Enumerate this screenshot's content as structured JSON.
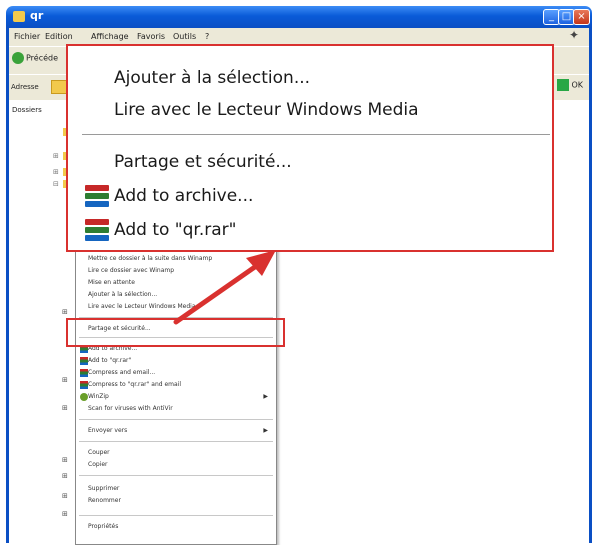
{
  "window": {
    "title": "qr"
  },
  "menubar": {
    "items": [
      "Fichier",
      "Edition",
      "Affichage",
      "Favoris",
      "Outils",
      "?"
    ]
  },
  "toolbar": {
    "back_label": "Précéde"
  },
  "addressbar": {
    "label": "Adresse",
    "ok_label": "OK"
  },
  "folders_pane": {
    "title": "Dossiers"
  },
  "zoom_menu": {
    "items": [
      "Ajouter à la sélection...",
      "Lire avec le Lecteur Windows Media",
      "Partage et sécurité...",
      "Add to archive...",
      "Add to \"qr.rar\""
    ]
  },
  "context_menu": {
    "items": [
      "Mettre ce dossier à la suite dans Winamp",
      "Lire ce dossier avec Winamp",
      "Mise en attente",
      "Ajouter à la sélection...",
      "Lire avec le Lecteur Windows Media",
      "Partage et sécurité...",
      "Add to archive...",
      "Add to \"qr.rar\"",
      "Compress and email...",
      "Compress to \"qr.rar\" and email",
      "WinZip",
      "Scan for viruses with AntiVir",
      "Envoyer vers",
      "Couper",
      "Copier",
      "Supprimer",
      "Renommer",
      "Propriétés"
    ]
  },
  "colors": {
    "callout_red": "#d9312f",
    "xp_blue": "#0a5bd8"
  }
}
